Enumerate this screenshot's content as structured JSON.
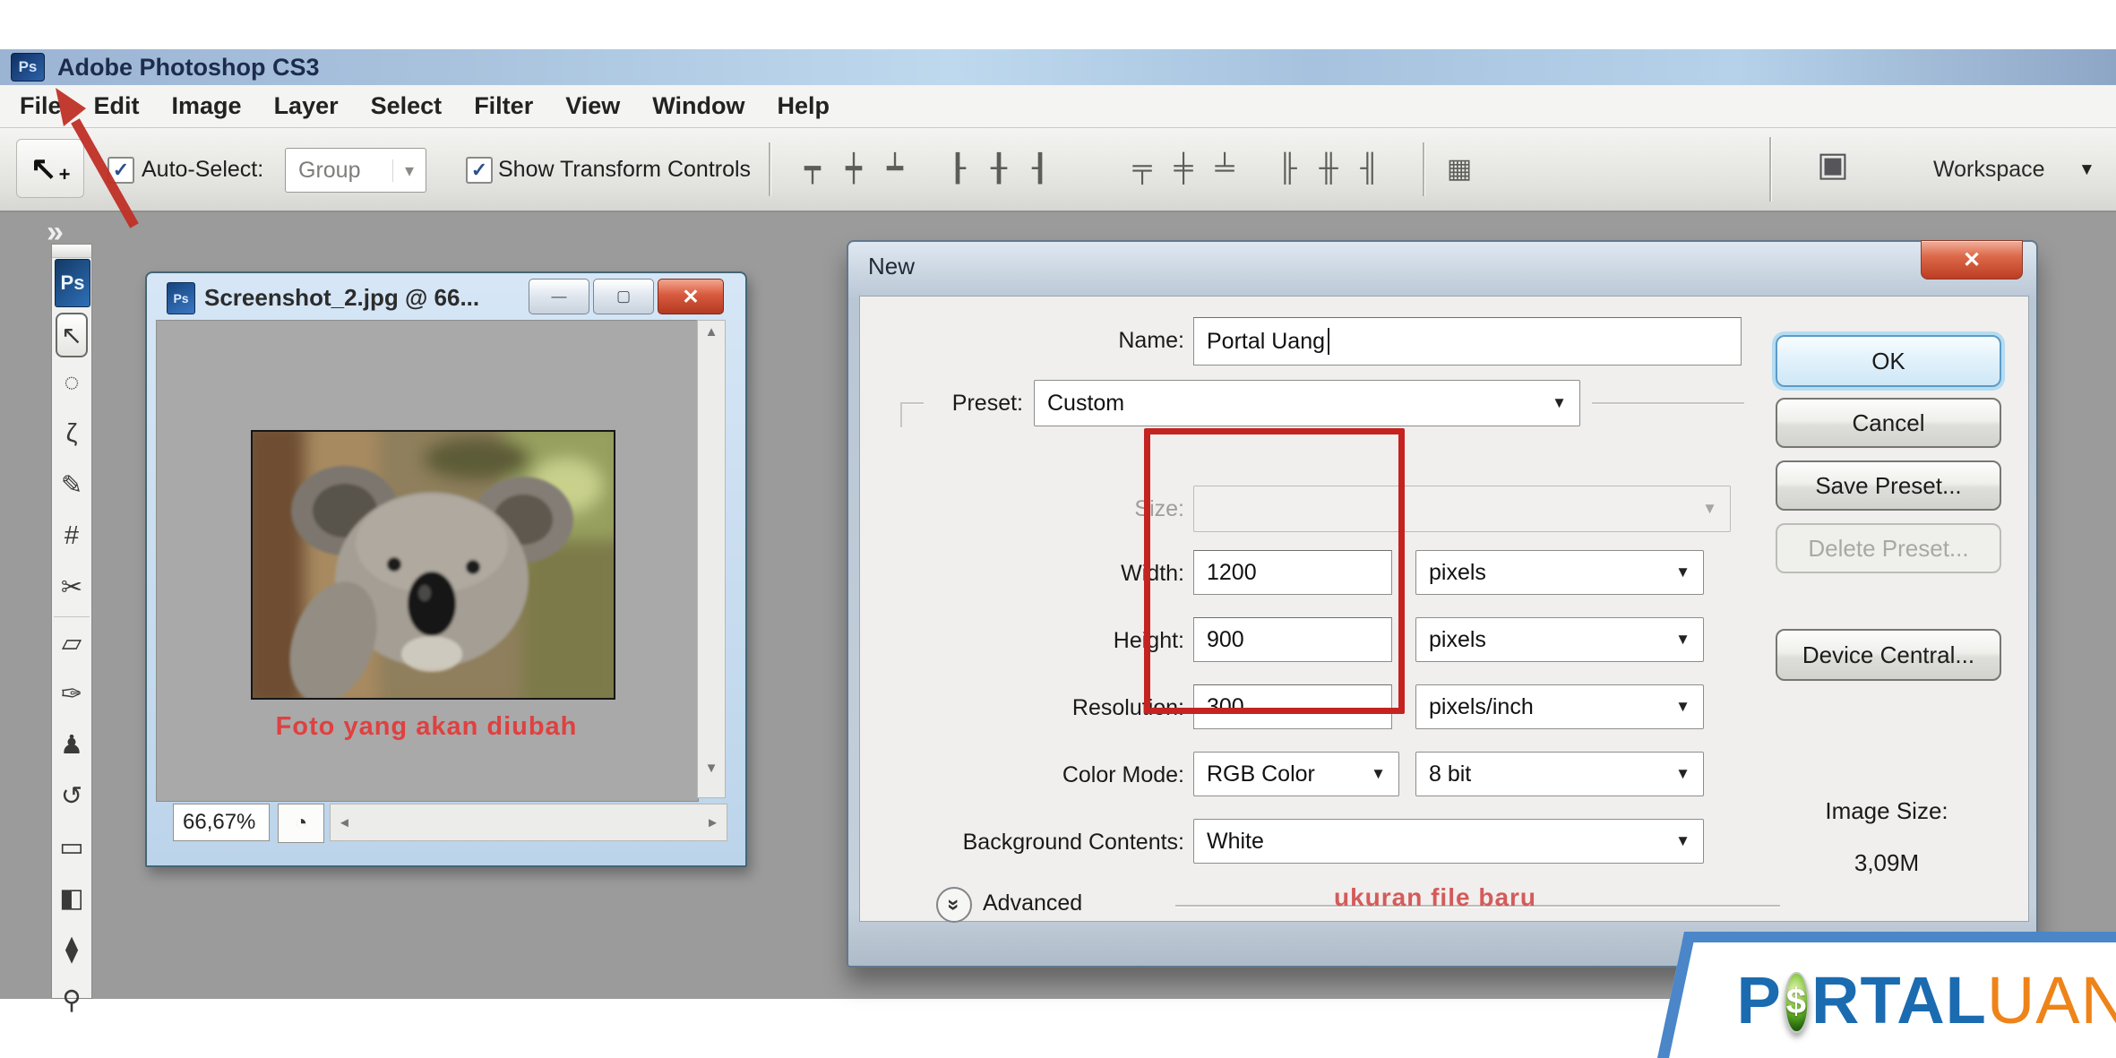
{
  "colors": {
    "highlight_red": "#c42320",
    "caption_red": "#e04040",
    "logo_blue": "#1b6bb0",
    "logo_orange": "#ee8419"
  },
  "title_bar": {
    "app_icon": "Ps",
    "title": "Adobe Photoshop CS3"
  },
  "menu_bar": {
    "items": [
      {
        "name": "menu-file",
        "label": "File"
      },
      {
        "name": "menu-edit",
        "label": "Edit"
      },
      {
        "name": "menu-image",
        "label": "Image"
      },
      {
        "name": "menu-layer",
        "label": "Layer"
      },
      {
        "name": "menu-select",
        "label": "Select"
      },
      {
        "name": "menu-filter",
        "label": "Filter"
      },
      {
        "name": "menu-view",
        "label": "View"
      },
      {
        "name": "menu-window",
        "label": "Window"
      },
      {
        "name": "menu-help",
        "label": "Help"
      }
    ]
  },
  "options_bar": {
    "check_glyph": "✓",
    "auto_select_label": "Auto-Select:",
    "group_value": "Group",
    "dropdown_arrow": "▾",
    "show_transform_label": "Show Transform Controls",
    "move_icon_glyph": "↖",
    "move_icon_plus": "+",
    "align_icons": [
      {
        "name": "align-top-edges-icon",
        "glyph": "┯"
      },
      {
        "name": "align-vertical-centers-icon",
        "glyph": "┿"
      },
      {
        "name": "align-bottom-edges-icon",
        "glyph": "┷"
      },
      {
        "name": "align-left-edges-icon",
        "glyph": "┠"
      },
      {
        "name": "align-horizontal-centers-icon",
        "glyph": "╂"
      },
      {
        "name": "align-right-edges-icon",
        "glyph": "┨"
      }
    ],
    "distribute_icons": [
      {
        "name": "distribute-top-edges-icon",
        "glyph": "╤"
      },
      {
        "name": "distribute-vertical-centers-icon",
        "glyph": "╪"
      },
      {
        "name": "distribute-bottom-edges-icon",
        "glyph": "╧"
      },
      {
        "name": "distribute-left-edges-icon",
        "glyph": "╟"
      },
      {
        "name": "distribute-horizontal-centers-icon",
        "glyph": "╫"
      },
      {
        "name": "distribute-right-edges-icon",
        "glyph": "╢"
      }
    ],
    "auto_align_glyph": "▦",
    "bridge_glyph": "▣",
    "workspace_label": "Workspace",
    "workspace_arrow": "▼"
  },
  "toolbar": {
    "collapse_glyph": "»",
    "logo": "Ps",
    "tools": [
      {
        "name": "move-tool",
        "glyph": "↖",
        "selected": true
      },
      {
        "name": "marquee-tool",
        "glyph": "◌"
      },
      {
        "name": "lasso-tool",
        "glyph": "ζ"
      },
      {
        "name": "quick-selection-tool",
        "glyph": "✎"
      },
      {
        "name": "crop-tool",
        "glyph": "#"
      },
      {
        "name": "slice-tool",
        "glyph": "✂"
      },
      {
        "name": "spot-healing-tool",
        "glyph": "▱"
      },
      {
        "name": "brush-tool",
        "glyph": "✑"
      },
      {
        "name": "clone-stamp-tool",
        "glyph": "♟"
      },
      {
        "name": "history-brush-tool",
        "glyph": "↺"
      },
      {
        "name": "eraser-tool",
        "glyph": "▭"
      },
      {
        "name": "gradient-tool",
        "glyph": "◧"
      },
      {
        "name": "blur-tool",
        "glyph": "⧫"
      },
      {
        "name": "zoom-tool",
        "glyph": "⚲"
      }
    ]
  },
  "document_window": {
    "icon_label": "Ps",
    "title": "Screenshot_2.jpg @ 66...",
    "minimize_glyph": "—",
    "maximize_glyph": "▢",
    "close_glyph": "✕",
    "caption": "Foto yang akan diubah",
    "zoom_level": "66,67%",
    "status_icon_glyph": "◔",
    "scroll_up_glyph": "▲",
    "scroll_down_glyph": "▼",
    "scroll_left_glyph": "◄",
    "scroll_right_glyph": "►"
  },
  "dialog": {
    "title": "New",
    "close_glyph": "✕",
    "dropdown_arrow": "▼",
    "name_label": "Name:",
    "name_value": "Portal Uang",
    "preset_label": "Preset:",
    "preset_value": "Custom",
    "size_label": "Size:",
    "width_label": "Width:",
    "width_value": "1200",
    "width_unit": "pixels",
    "height_label": "Height:",
    "height_value": "900",
    "height_unit": "pixels",
    "resolution_label": "Resolution:",
    "resolution_value": "300",
    "resolution_unit": "pixels/inch",
    "color_mode_label": "Color Mode:",
    "color_mode_value": "RGB Color",
    "bit_depth_value": "8 bit",
    "background_label": "Background Contents:",
    "background_value": "White",
    "advanced_label": "Advanced",
    "advanced_chevron": "»",
    "ok_label": "OK",
    "cancel_label": "Cancel",
    "save_preset_label": "Save Preset...",
    "delete_preset_label": "Delete Preset...",
    "device_central_label": "Device Central...",
    "image_size_label": "Image Size:",
    "image_size_value": "3,09M",
    "annotation": "ukuran file baru"
  },
  "logo": {
    "p": "P",
    "dollar": "$",
    "rtal": "RTAL",
    "uang": "UANG"
  }
}
